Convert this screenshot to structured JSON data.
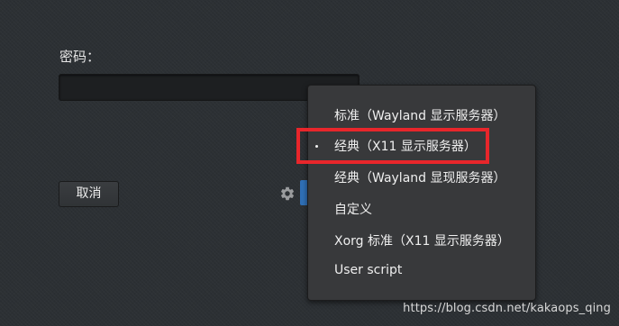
{
  "login": {
    "password_label": "密码："
  },
  "buttons": {
    "cancel_label": "取消"
  },
  "icons": {
    "settings": "gear-icon"
  },
  "session_menu": {
    "items": [
      {
        "label": "标准（Wayland 显示服务器）",
        "selected": false
      },
      {
        "label": "经典（X11 显示服务器）",
        "selected": true
      },
      {
        "label": "经典（Wayland 显现服务器）",
        "selected": false
      },
      {
        "label": "自定义",
        "selected": false
      },
      {
        "label": "Xorg 标准（X11 显示服务器）",
        "selected": false
      },
      {
        "label": "User script",
        "selected": false
      }
    ]
  },
  "annotation": {
    "highlight_color": "#e8262b"
  },
  "watermark": {
    "text": "https://blog.csdn.net/kakaops_qing"
  }
}
